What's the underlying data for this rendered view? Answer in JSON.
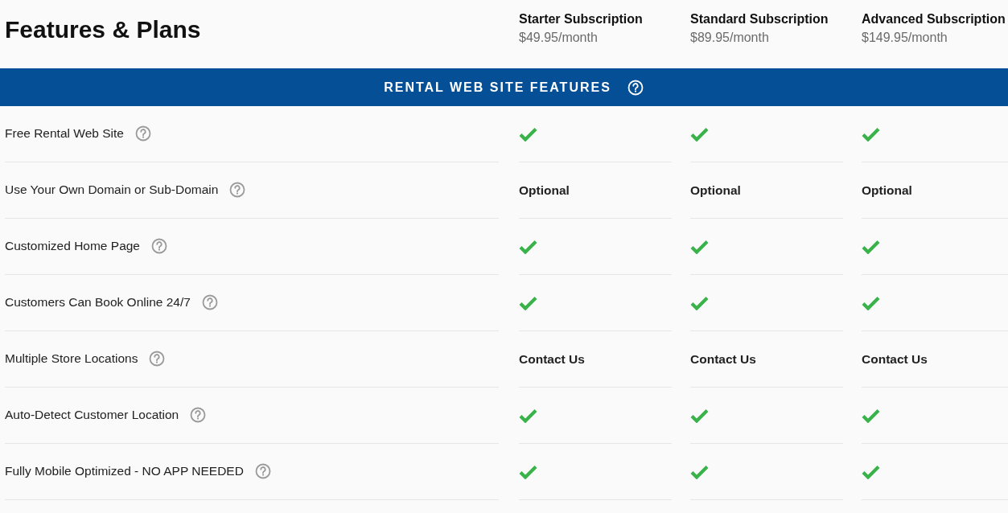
{
  "title": "Features & Plans",
  "plans": [
    {
      "name": "Starter Subscription",
      "price": "$49.95/month"
    },
    {
      "name": "Standard Subscription",
      "price": "$89.95/month"
    },
    {
      "name": "Advanced Subscription",
      "price": "$149.95/month"
    }
  ],
  "section": {
    "title": "RENTAL WEB SITE FEATURES"
  },
  "rows": [
    {
      "feature": "Free Rental Web Site",
      "cells": [
        {
          "kind": "check"
        },
        {
          "kind": "check"
        },
        {
          "kind": "check"
        }
      ]
    },
    {
      "feature": "Use Your Own Domain or Sub-Domain",
      "cells": [
        {
          "kind": "text",
          "text": "Optional"
        },
        {
          "kind": "text",
          "text": "Optional"
        },
        {
          "kind": "text",
          "text": "Optional"
        }
      ]
    },
    {
      "feature": "Customized Home Page",
      "cells": [
        {
          "kind": "check"
        },
        {
          "kind": "check"
        },
        {
          "kind": "check"
        }
      ]
    },
    {
      "feature": "Customers Can Book Online 24/7",
      "cells": [
        {
          "kind": "check"
        },
        {
          "kind": "check"
        },
        {
          "kind": "check"
        }
      ]
    },
    {
      "feature": "Multiple Store Locations",
      "cells": [
        {
          "kind": "text",
          "text": "Contact Us"
        },
        {
          "kind": "text",
          "text": "Contact Us"
        },
        {
          "kind": "text",
          "text": "Contact Us"
        }
      ]
    },
    {
      "feature": "Auto-Detect Customer Location",
      "cells": [
        {
          "kind": "check"
        },
        {
          "kind": "check"
        },
        {
          "kind": "check"
        }
      ]
    },
    {
      "feature": "Fully Mobile Optimized - NO APP NEEDED",
      "cells": [
        {
          "kind": "check"
        },
        {
          "kind": "check"
        },
        {
          "kind": "check"
        }
      ]
    }
  ]
}
